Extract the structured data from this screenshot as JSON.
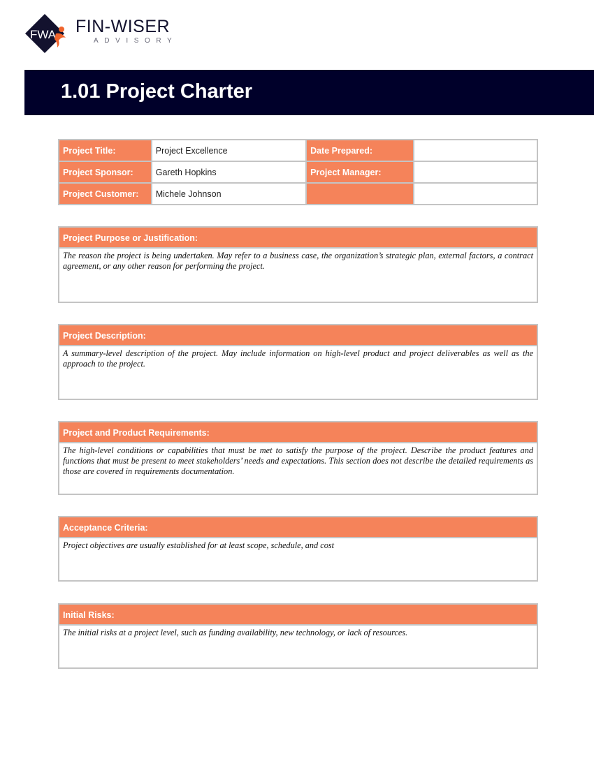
{
  "logo": {
    "monogram": "FWA",
    "name": "FIN-WISER",
    "subtitle": "ADVISORY",
    "colors": {
      "navy": "#13122e",
      "orange": "#f0642c"
    }
  },
  "title": "1.01 Project Charter",
  "info_table": {
    "rows": [
      {
        "label1": "Project Title:",
        "value1": "Project Excellence",
        "label2": "Date Prepared:",
        "value2": ""
      },
      {
        "label1": "Project Sponsor:",
        "value1": "Gareth Hopkins",
        "label2": "Project Manager:",
        "value2": ""
      },
      {
        "label1": "Project Customer:",
        "value1": "Michele Johnson",
        "label2": "",
        "value2": ""
      }
    ]
  },
  "sections": [
    {
      "heading": "Project Purpose or Justification:",
      "text": "The reason the project is being undertaken. May refer to a business case, the organization’s strategic plan, external factors, a contract agreement, or any other reason for performing the project."
    },
    {
      "heading": "Project Description:",
      "text": "A summary-level description of the project. May include information on high-level product and project deliverables as well as the approach to the project."
    },
    {
      "heading": "Project and Product Requirements:",
      "text": "The high-level conditions or capabilities that must be met to satisfy the purpose of the project. Describe the product features and functions that must be present to meet stakeholders’ needs and expectations. This section does not describe the detailed requirements as those are covered in requirements documentation."
    },
    {
      "heading": "Acceptance Criteria:",
      "text": "Project objectives are usually established for at least scope, schedule, and cost"
    },
    {
      "heading": "Initial Risks:",
      "text": "The initial risks at a project level, such as funding availability, new technology, or lack of resources."
    }
  ],
  "colors": {
    "header_bar": "#00002a",
    "label_fill": "#f5835a",
    "border": "#c4c4c4"
  }
}
